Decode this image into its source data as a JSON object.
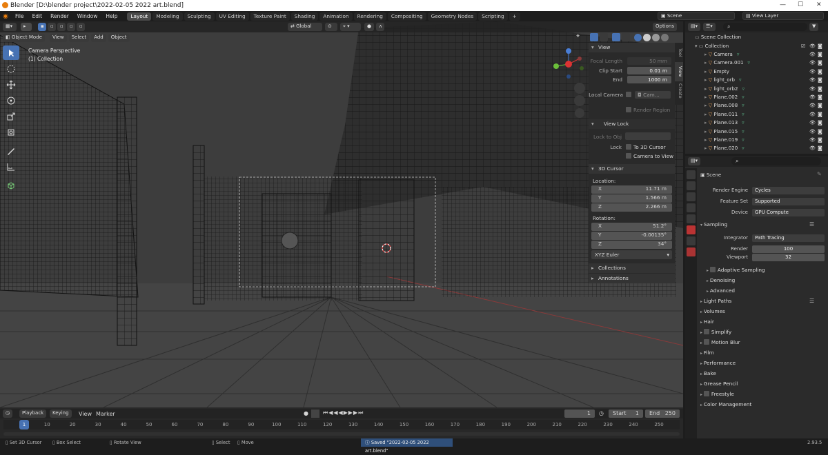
{
  "window": {
    "title": "Blender [D:\\blender project\\2022-02-05 2022 art.blend]",
    "controls": [
      "—",
      "☐",
      "✕"
    ]
  },
  "menu": [
    "File",
    "Edit",
    "Render",
    "Window",
    "Help"
  ],
  "workspaces": [
    "Layout",
    "Modeling",
    "Sculpting",
    "UV Editing",
    "Texture Paint",
    "Shading",
    "Animation",
    "Rendering",
    "Compositing",
    "Geometry Nodes",
    "Scripting"
  ],
  "workspace_add": "+",
  "scene": {
    "label": "Scene",
    "view_layer": "View Layer"
  },
  "viewport": {
    "mode": "Object Mode",
    "menus": [
      "View",
      "Select",
      "Add",
      "Object"
    ],
    "orientation": "Global",
    "options": "Options",
    "overlay_title": "Camera Perspective",
    "overlay_sub": "(1) Collection"
  },
  "npanel": {
    "view_header": "View",
    "focal_label": "Focal Length",
    "focal_value": "50 mm",
    "clip_start_label": "Clip Start",
    "clip_start_value": "0.01 m",
    "clip_end_label": "End",
    "clip_end_value": "1000 m",
    "local_camera_label": "Local Camera",
    "local_camera_value": "Cam...",
    "render_region": "Render Region",
    "view_lock_header": "View Lock",
    "lock_to_obj": "Lock to Obj",
    "lock_label": "Lock",
    "to_3d_cursor": "To 3D Cursor",
    "camera_to_view": "Camera to View",
    "cursor_header": "3D Cursor",
    "location_label": "Location:",
    "loc": [
      {
        "axis": "X",
        "value": "11.71 m"
      },
      {
        "axis": "Y",
        "value": "1.566 m"
      },
      {
        "axis": "Z",
        "value": "2.266 m"
      }
    ],
    "rotation_label": "Rotation:",
    "rot": [
      {
        "axis": "X",
        "value": "51.2°"
      },
      {
        "axis": "Y",
        "value": "-0.00135°"
      },
      {
        "axis": "Z",
        "value": "34°"
      }
    ],
    "rotation_mode": "XYZ Euler",
    "collections": "Collections",
    "annotations": "Annotations",
    "tabs": [
      "Tool",
      "View",
      "Create"
    ]
  },
  "outliner": {
    "root": "Scene Collection",
    "collection": "Collection",
    "items": [
      "Camera",
      "Camera.001",
      "Empty",
      "light_orb",
      "light_orb2",
      "Plane.002",
      "Plane.008",
      "Plane.011",
      "Plane.013",
      "Plane.015",
      "Plane.019",
      "Plane.020"
    ]
  },
  "properties": {
    "breadcrumb": "Scene",
    "render_engine_label": "Render Engine",
    "render_engine": "Cycles",
    "feature_set_label": "Feature Set",
    "feature_set": "Supported",
    "device_label": "Device",
    "device": "GPU Compute",
    "sampling": "Sampling",
    "integrator_label": "Integrator",
    "integrator": "Path Tracing",
    "render_label": "Render",
    "render_samples": "100",
    "viewport_label": "Viewport",
    "viewport_samples": "32",
    "adaptive": "Adaptive Sampling",
    "denoising": "Denoising",
    "advanced": "Advanced",
    "sections": [
      {
        "label": "Light Paths",
        "check": false
      },
      {
        "label": "Volumes",
        "check": false
      },
      {
        "label": "Hair",
        "check": false
      },
      {
        "label": "Simplify",
        "check": true
      },
      {
        "label": "Motion Blur",
        "check": true
      },
      {
        "label": "Film",
        "check": false
      },
      {
        "label": "Performance",
        "check": false
      },
      {
        "label": "Bake",
        "check": false
      },
      {
        "label": "Grease Pencil",
        "check": false
      },
      {
        "label": "Freestyle",
        "check": true
      },
      {
        "label": "Color Management",
        "check": false
      }
    ]
  },
  "timeline": {
    "menus": [
      "Playback",
      "Keying",
      "View",
      "Marker"
    ],
    "current_frame": "1",
    "start_label": "Start",
    "start": "1",
    "end_label": "End",
    "end": "250",
    "ticks": [
      "1",
      "10",
      "20",
      "30",
      "40",
      "50",
      "60",
      "70",
      "80",
      "90",
      "100",
      "110",
      "120",
      "130",
      "140",
      "150",
      "160",
      "170",
      "180",
      "190",
      "200",
      "210",
      "220",
      "230",
      "240",
      "250"
    ]
  },
  "status": {
    "items": [
      "Set 3D Cursor",
      "Box Select",
      "Rotate View",
      "Select",
      "Move"
    ],
    "message": "Saved \"2022-02-05 2022 art.blend\"",
    "version": "2.93.5"
  },
  "colors": {
    "accent": "#4772b3",
    "save_msg": "#2f4f7a",
    "header": "#232323",
    "panel": "#2b2b2b"
  }
}
